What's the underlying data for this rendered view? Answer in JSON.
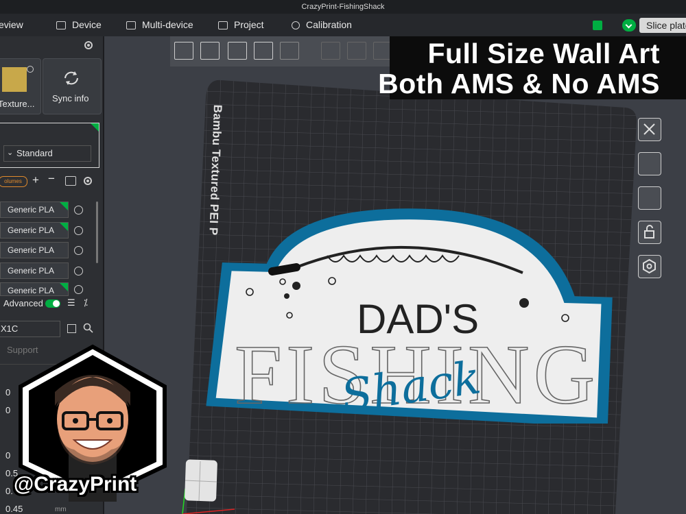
{
  "window": {
    "title": "CrazyPrint-FishingShack"
  },
  "menu": {
    "items": [
      {
        "label": "eview"
      },
      {
        "label": "Device"
      },
      {
        "label": "Multi-device"
      },
      {
        "label": "Project"
      },
      {
        "label": "Calibration"
      }
    ],
    "slice_label": "Slice plate"
  },
  "sidebar": {
    "texture_label": "Texture...",
    "sync_label": "Sync info",
    "preset_value": "Standard",
    "volumes_badge": "olumes",
    "filaments": [
      "Generic PLA",
      "Generic PLA",
      "Generic PLA",
      "Generic PLA",
      "Generic PLA"
    ],
    "advanced_label": "Advanced",
    "printer_value": "X1C",
    "support_label": "Support",
    "field_values": [
      "0",
      "0",
      "0",
      "0.5",
      "0.",
      "0.45"
    ],
    "unit": "mm"
  },
  "bed": {
    "label": "Bambu Textured PEI P"
  },
  "sign": {
    "line1": "DAD'S",
    "line2": "FISHING",
    "line3": "Shack"
  },
  "headline": {
    "line1": "Full Size Wall Art",
    "line2": "Both AMS & No AMS"
  },
  "handle": "@CrazyPrint",
  "colors": {
    "accent_green": "#00ae42",
    "sign_blue": "#0d6e9c",
    "bed": "#2a2b2f"
  }
}
